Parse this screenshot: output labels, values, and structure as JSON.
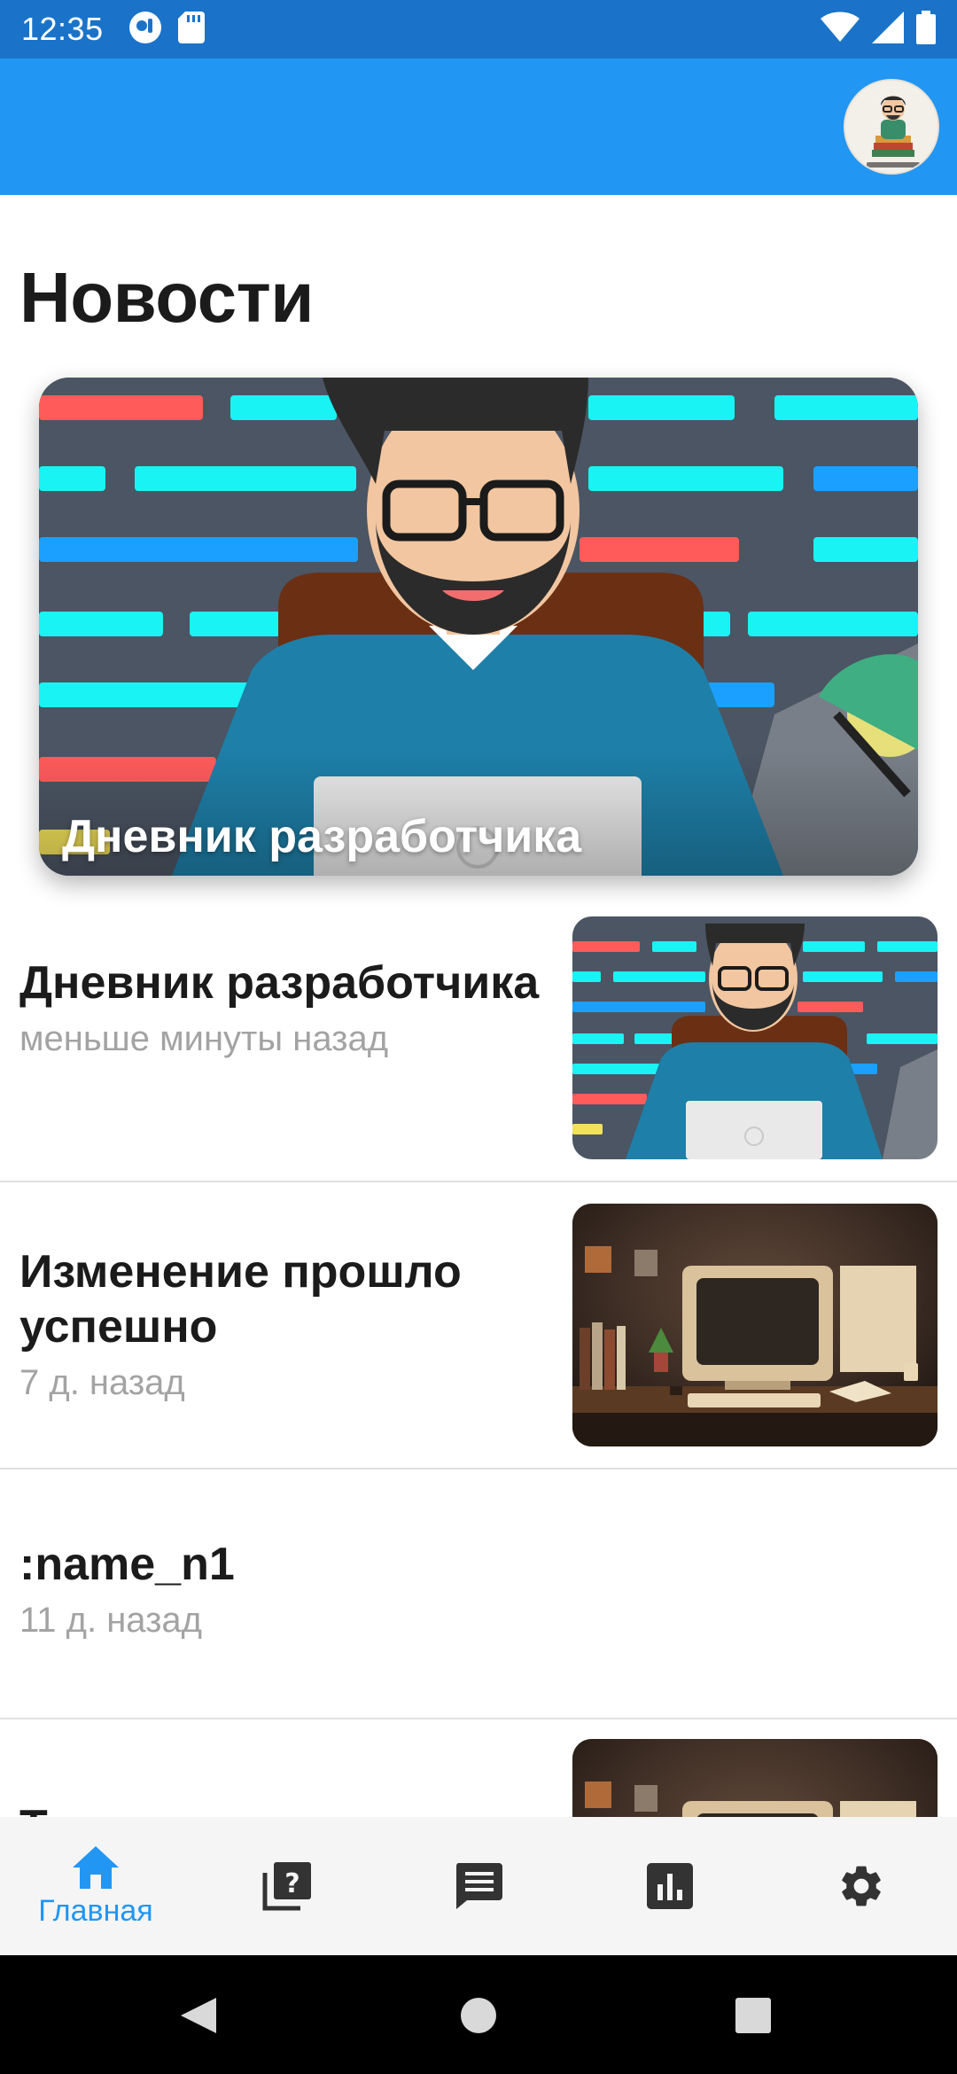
{
  "status_bar": {
    "time": "12:35",
    "icons": [
      "camera-notification-icon",
      "sd-card-icon",
      "wifi-icon",
      "signal-icon",
      "battery-icon"
    ]
  },
  "app_bar": {
    "avatar_icon": "students-life-avatar"
  },
  "page": {
    "title": "Новости"
  },
  "featured": {
    "caption": "Дневник разработчика",
    "image": "developer-illustration"
  },
  "news": [
    {
      "title": "Дневник разработчика",
      "time": "меньше минуты назад",
      "image": "developer-illustration"
    },
    {
      "title": "Изменение прошло успешно",
      "time": "7 д. назад",
      "image": "retro-computer-illustration"
    },
    {
      "title": ":name_n1",
      "time": "11 д. назад",
      "image": ""
    },
    {
      "title": "Т",
      "time": "",
      "image": "retro-computer-illustration"
    }
  ],
  "bottom_nav": {
    "items": [
      {
        "icon": "home-icon",
        "label": "Главная",
        "active": true
      },
      {
        "icon": "quiz-icon",
        "label": "",
        "active": false
      },
      {
        "icon": "chat-icon",
        "label": "",
        "active": false
      },
      {
        "icon": "stats-icon",
        "label": "",
        "active": false
      },
      {
        "icon": "gear-icon",
        "label": "",
        "active": false
      }
    ]
  },
  "colors": {
    "status_bar": "#1a73c9",
    "app_bar": "#2196f3",
    "accent": "#2196f3",
    "icon_inactive": "#333333",
    "text_primary": "#1b1b1b",
    "text_secondary": "#a3a3a3"
  }
}
